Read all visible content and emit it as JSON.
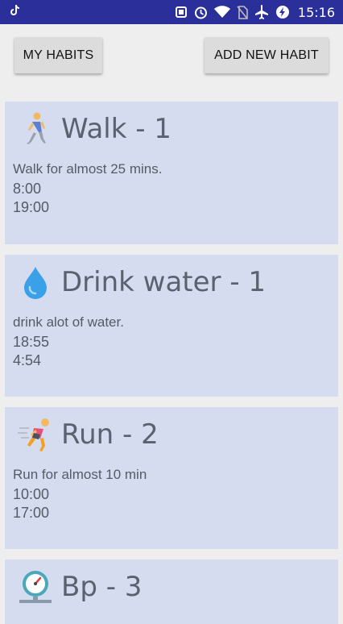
{
  "status_bar": {
    "time": "15:16",
    "icons": [
      "tiktok-icon",
      "cast-icon",
      "alarm-icon",
      "wifi-icon",
      "no-sim-icon",
      "airplane-icon",
      "battery-saver-icon"
    ]
  },
  "toolbar": {
    "my_habits_label": "MY HABITS",
    "add_new_habit_label": "ADD NEW HABIT"
  },
  "habits": [
    {
      "title": "Walk - 1",
      "description": "Walk for almost 25 mins.",
      "times": [
        "8:00",
        "19:00"
      ],
      "icon": "walking-person-icon"
    },
    {
      "title": "Drink water - 1",
      "description": "drink alot of water.",
      "times": [
        "18:55",
        "4:54"
      ],
      "icon": "water-drop-icon"
    },
    {
      "title": "Run - 2",
      "description": "Run for almost 10 min",
      "times": [
        "10:00",
        "17:00"
      ],
      "icon": "running-person-icon"
    },
    {
      "title": "Bp - 3",
      "icon": "gauge-icon"
    }
  ],
  "colors": {
    "status_bar": "#2a2f9a",
    "card_background": "#d5dcef",
    "page_background": "#eeeeee",
    "button_background": "#dcdcdc"
  }
}
